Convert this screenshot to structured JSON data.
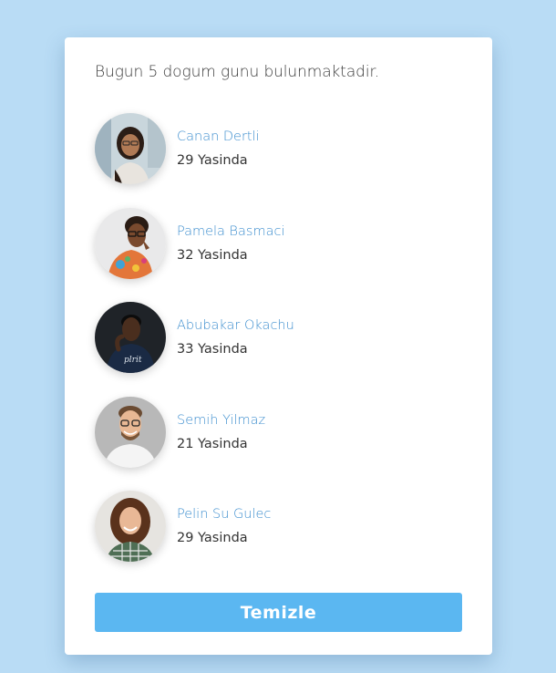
{
  "header": {
    "title": "Bugun 5 dogum gunu bulunmaktadir."
  },
  "people": [
    {
      "name": "Canan Dertli",
      "age": "29 Yasinda"
    },
    {
      "name": "Pamela Basmaci",
      "age": "32 Yasinda"
    },
    {
      "name": "Abubakar Okachu",
      "age": "33 Yasinda"
    },
    {
      "name": "Semih Yilmaz",
      "age": "21 Yasinda"
    },
    {
      "name": "Pelin Su Gulec",
      "age": "29 Yasinda"
    }
  ],
  "actions": {
    "clear_label": "Temizle"
  },
  "colors": {
    "background": "#b9dcf5",
    "name": "#3f8fcf",
    "button": "#5bb7f1"
  }
}
